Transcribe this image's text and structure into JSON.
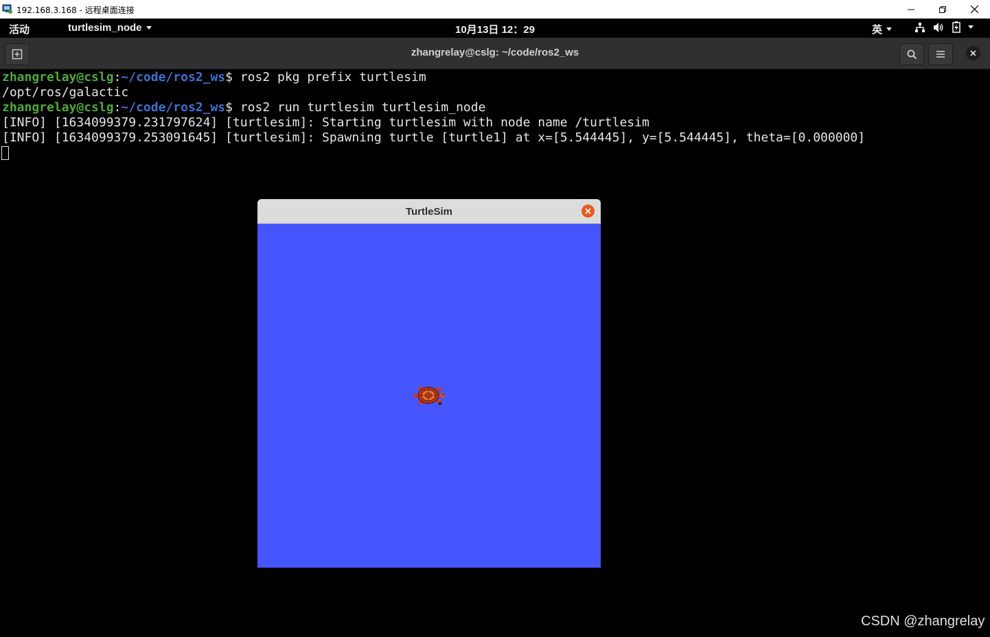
{
  "rdp": {
    "title": "192.168.3.168 - 远程桌面连接"
  },
  "gnome_bar": {
    "activities": "活动",
    "app_menu": "turtlesim_node",
    "clock": "10月13日  12：29",
    "input_method": "英"
  },
  "terminal_header": {
    "title": "zhangrelay@cslg: ~/code/ros2_ws"
  },
  "terminal": {
    "prompt_user": "zhangrelay@cslg",
    "prompt_sep": ":",
    "prompt_path": "~/code/ros2_ws",
    "prompt_dollar": "$ ",
    "cmd1": "ros2 pkg prefix turtlesim",
    "out1": "/opt/ros/galactic",
    "cmd2": "ros2 run turtlesim turtlesim_node",
    "out2": "[INFO] [1634099379.231797624] [turtlesim]: Starting turtlesim with node name /turtlesim",
    "out3": "[INFO] [1634099379.253091645] [turtlesim]: Spawning turtle [turtle1] at x=[5.544445], y=[5.544445], theta=[0.000000]"
  },
  "turtlesim": {
    "title": "TurtleSim",
    "background_color": "#4556ff"
  },
  "watermark": "CSDN @zhangrelay",
  "icons": [
    "rdp-app-icon",
    "minimize-icon",
    "restore-icon",
    "close-icon",
    "caret-down-icon",
    "network-icon",
    "volume-icon",
    "battery-icon",
    "new-tab-icon",
    "search-icon",
    "menu-icon",
    "close-icon",
    "turtle-icon"
  ]
}
